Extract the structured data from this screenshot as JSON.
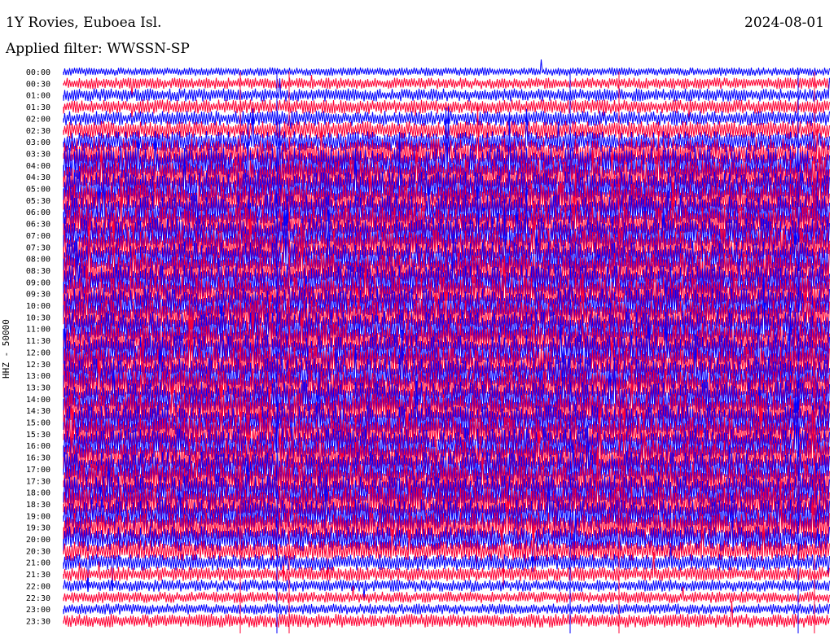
{
  "header": {
    "station_title": "1Y Rovies, Euboea Isl.",
    "filter_label": "Applied filter: WWSSN-SP",
    "date": "2024-08-01"
  },
  "side_label": "HHZ - 50000",
  "colors": {
    "trace_a": "#0000ff",
    "trace_b": "#ff0033",
    "background": "#ffffff",
    "text": "#000000"
  },
  "chart_data": {
    "type": "line",
    "title": "1Y Rovies, Euboea Isl.",
    "subtitle": "Applied filter: WWSSN-SP",
    "ylabel": "HHZ - 50000",
    "grid": false,
    "legend": "none",
    "row_labels": [
      "00:00",
      "00:30",
      "01:00",
      "01:30",
      "02:00",
      "02:30",
      "03:00",
      "03:30",
      "04:00",
      "04:30",
      "05:00",
      "05:30",
      "06:00",
      "06:30",
      "07:00",
      "07:30",
      "08:00",
      "08:30",
      "09:00",
      "09:30",
      "10:00",
      "10:30",
      "11:00",
      "11:30",
      "12:00",
      "12:30",
      "13:00",
      "13:30",
      "14:00",
      "14:30",
      "15:00",
      "15:30",
      "16:00",
      "16:30",
      "17:00",
      "17:30",
      "18:00",
      "18:30",
      "19:00",
      "19:30",
      "20:00",
      "20:30",
      "21:00",
      "21:30",
      "22:00",
      "22:30",
      "23:00",
      "23:30"
    ],
    "row_colors": [
      "blue",
      "red",
      "blue",
      "red",
      "blue",
      "red",
      "blue",
      "red",
      "blue",
      "red",
      "blue",
      "red",
      "blue",
      "red",
      "blue",
      "red",
      "blue",
      "red",
      "blue",
      "red",
      "blue",
      "red",
      "blue",
      "red",
      "blue",
      "red",
      "blue",
      "red",
      "blue",
      "red",
      "blue",
      "red",
      "blue",
      "red",
      "blue",
      "red",
      "blue",
      "red",
      "blue",
      "red",
      "blue",
      "red",
      "blue",
      "red",
      "blue",
      "red",
      "blue",
      "red"
    ],
    "row_activity": [
      0.12,
      0.22,
      0.28,
      0.32,
      0.35,
      0.45,
      0.55,
      0.85,
      1.0,
      1.0,
      1.0,
      1.0,
      1.0,
      1.0,
      1.0,
      1.0,
      1.0,
      1.0,
      1.0,
      1.0,
      1.0,
      1.0,
      1.0,
      1.0,
      1.0,
      1.0,
      1.0,
      1.0,
      1.0,
      1.0,
      1.0,
      1.0,
      1.0,
      1.0,
      1.0,
      1.0,
      1.0,
      1.0,
      0.95,
      0.85,
      0.7,
      0.55,
      0.4,
      0.32,
      0.25,
      0.22,
      0.2,
      0.3
    ]
  }
}
